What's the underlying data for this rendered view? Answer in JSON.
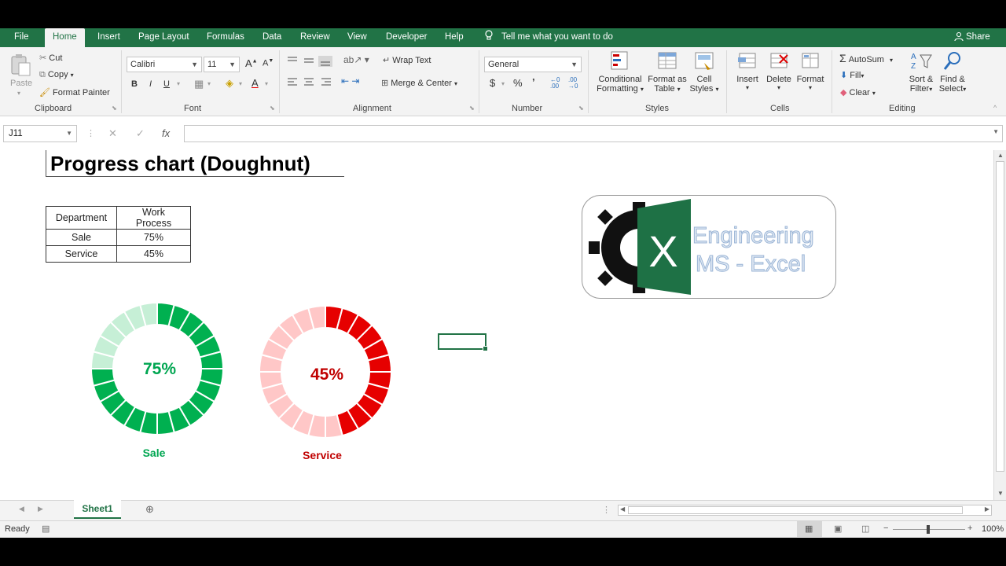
{
  "menu": {
    "file": "File",
    "home": "Home",
    "insert": "Insert",
    "page_layout": "Page Layout",
    "formulas": "Formulas",
    "data": "Data",
    "review": "Review",
    "view": "View",
    "developer": "Developer",
    "help": "Help",
    "tell_me": "Tell me what you want to do",
    "share": "Share"
  },
  "ribbon": {
    "clipboard": {
      "paste": "Paste",
      "cut": "Cut",
      "copy": "Copy",
      "format_painter": "Format Painter",
      "label": "Clipboard"
    },
    "font": {
      "name": "Calibri",
      "size": "11",
      "label": "Font",
      "bold": "B",
      "italic": "I",
      "underline": "U",
      "grow": "A",
      "shrink": "A",
      "color": "A"
    },
    "alignment": {
      "wrap_text": "Wrap Text",
      "merge_center": "Merge & Center",
      "label": "Alignment"
    },
    "number": {
      "format": "General",
      "currency": "$",
      "percent": "%",
      "comma": "’",
      "label": "Number"
    },
    "styles": {
      "conditional_1": "Conditional",
      "conditional_2": "Formatting",
      "format_table_1": "Format as",
      "format_table_2": "Table",
      "cell_styles_1": "Cell",
      "cell_styles_2": "Styles",
      "label": "Styles"
    },
    "cells": {
      "insert": "Insert",
      "delete": "Delete",
      "format": "Format",
      "label": "Cells"
    },
    "editing": {
      "autosum": "AutoSum",
      "fill": "Fill",
      "clear": "Clear",
      "sort_1": "Sort &",
      "sort_2": "Filter",
      "find_1": "Find &",
      "find_2": "Select",
      "label": "Editing"
    }
  },
  "formula_bar": {
    "name_box": "J11",
    "fx": "fx",
    "content": ""
  },
  "sheet": {
    "title": "Progress chart (Doughnut)",
    "table": {
      "headers": [
        "Department",
        "Work Process"
      ],
      "rows": [
        [
          "Sale",
          "75%"
        ],
        [
          "Service",
          "45%"
        ]
      ]
    },
    "logo": {
      "line1": "Engineering",
      "line2": "MS - Excel",
      "letter": "X"
    }
  },
  "chart_data": [
    {
      "type": "pie",
      "subtype": "doughnut",
      "title": "",
      "center_label": "75%",
      "category_label": "Sale",
      "values": [
        75,
        25
      ],
      "segments": 24,
      "colors": {
        "filled": "#00b050",
        "empty": "#c6efd6",
        "label": "#00a651"
      }
    },
    {
      "type": "pie",
      "subtype": "doughnut",
      "title": "",
      "center_label": "45%",
      "category_label": "Service",
      "values": [
        45,
        55
      ],
      "segments": 24,
      "colors": {
        "filled": "#e60000",
        "empty": "#ffc7c7",
        "label": "#c00000"
      }
    }
  ],
  "tabs": {
    "sheet1": "Sheet1"
  },
  "status": {
    "ready": "Ready",
    "zoom": "100%"
  },
  "colors": {
    "excel_green": "#217346"
  }
}
